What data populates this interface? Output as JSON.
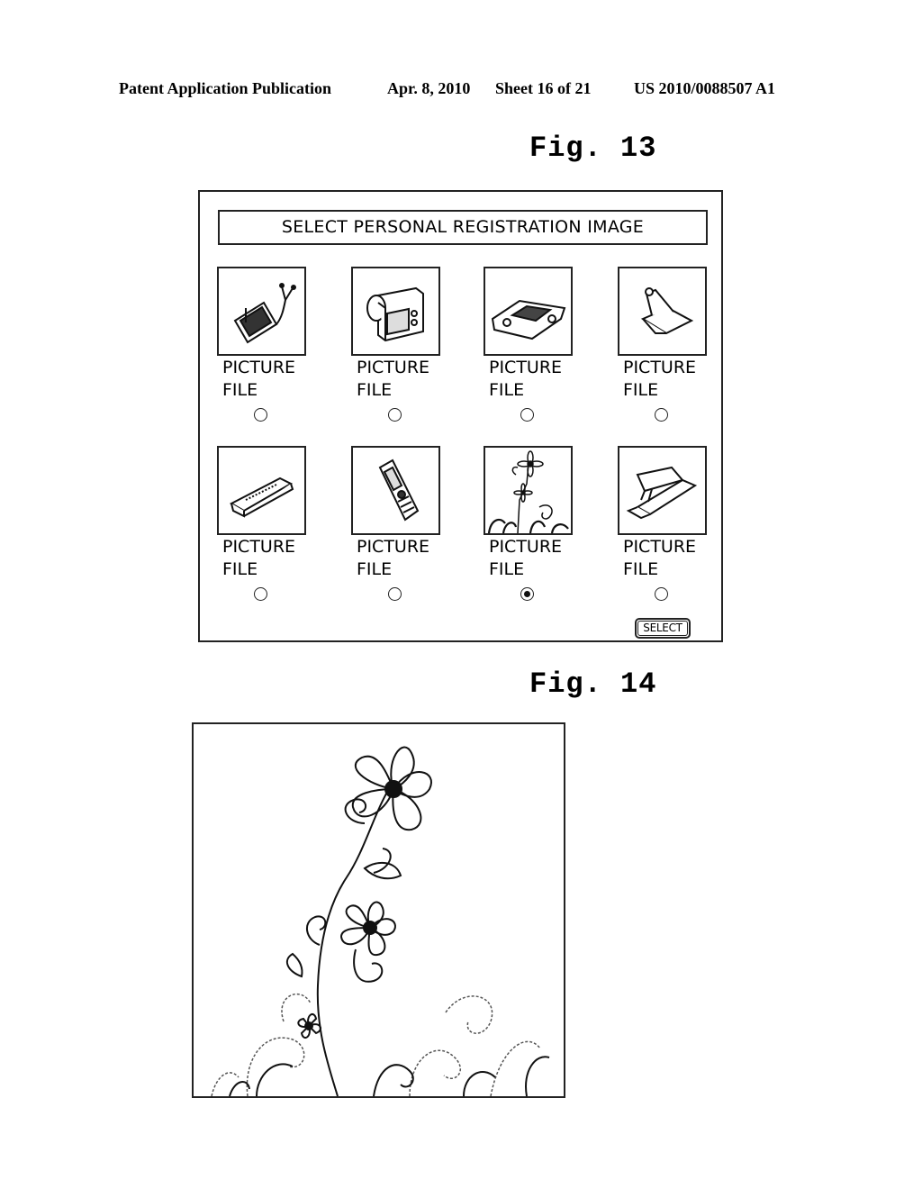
{
  "header": {
    "publication": "Patent Application Publication",
    "date": "Apr. 8, 2010",
    "sheet": "Sheet 16 of 21",
    "patent_number": "US 2010/0088507 A1"
  },
  "figures": {
    "fig13_label": "Fig. 13",
    "fig14_label": "Fig. 14"
  },
  "dialog": {
    "title": "SELECT PERSONAL REGISTRATION IMAGE",
    "select_button": "SELECT",
    "selected_index": 6,
    "items": [
      {
        "icon": "pmp-player-icon",
        "line1": "PICTURE",
        "line2": "FILE",
        "selected": false
      },
      {
        "icon": "digital-camera-icon",
        "line1": "PICTURE",
        "line2": "FILE",
        "selected": false
      },
      {
        "icon": "game-console-icon",
        "line1": "PICTURE",
        "line2": "FILE",
        "selected": false
      },
      {
        "icon": "binder-clip-icon",
        "line1": "PICTURE",
        "line2": "FILE",
        "selected": false
      },
      {
        "icon": "usb-drive-icon",
        "line1": "PICTURE",
        "line2": "FILE",
        "selected": false
      },
      {
        "icon": "mobile-phone-icon",
        "line1": "PICTURE",
        "line2": "FILE",
        "selected": false
      },
      {
        "icon": "flower-icon",
        "line1": "PICTURE",
        "line2": "FILE",
        "selected": true
      },
      {
        "icon": "staple-remover-icon",
        "line1": "PICTURE",
        "line2": "FILE",
        "selected": false
      }
    ]
  },
  "enlarged_image": {
    "subject": "flower-illustration"
  }
}
